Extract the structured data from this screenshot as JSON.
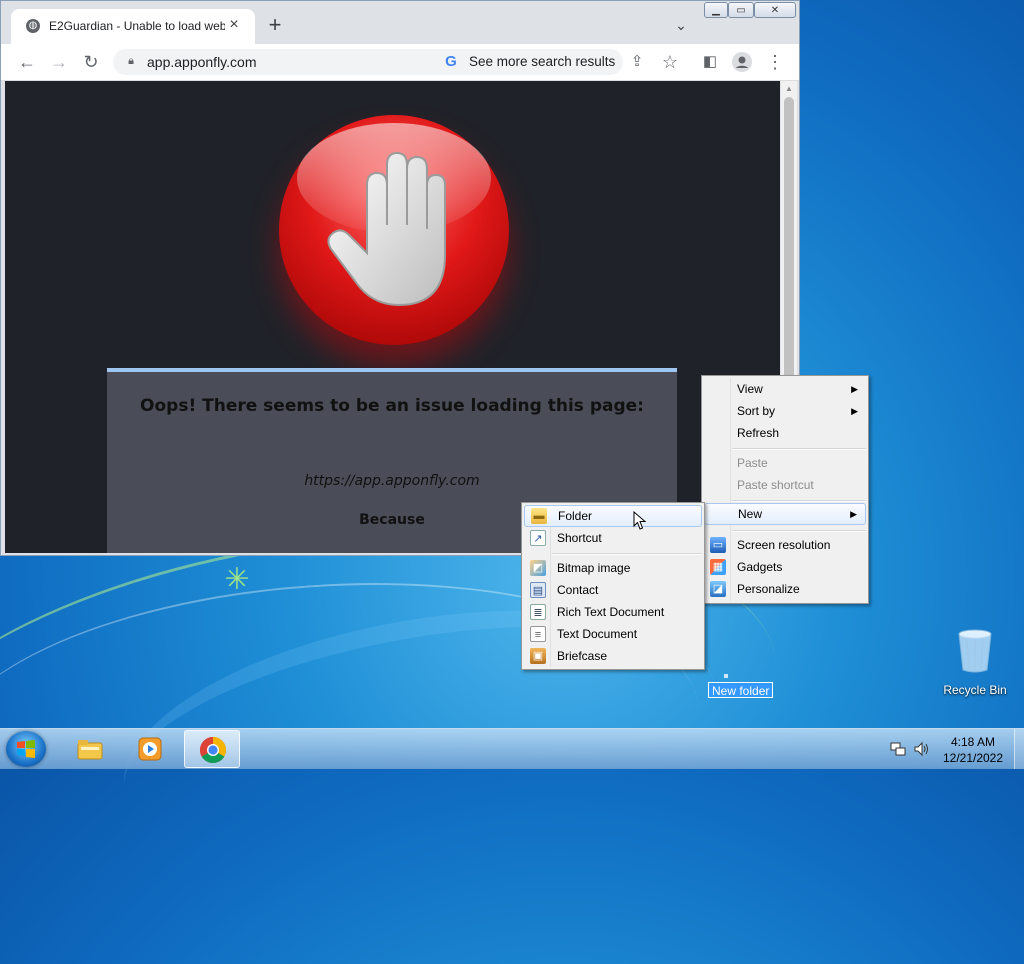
{
  "browser": {
    "tab_title": "E2Guardian - Unable to load web page",
    "url": "app.apponfly.com",
    "search_chip": "See more search results",
    "window_controls": {
      "minimize": "minimize-icon",
      "maximize": "maximize-icon",
      "close": "close-icon"
    }
  },
  "page": {
    "title": "Oops! There seems to be an issue loading this page:",
    "blocked_url": "https://app.apponfly.com",
    "because": "Because"
  },
  "context_menu": {
    "items": [
      {
        "label": "View",
        "submenu": true
      },
      {
        "label": "Sort by",
        "submenu": true
      },
      {
        "label": "Refresh"
      },
      {
        "label": "Paste",
        "disabled": true
      },
      {
        "label": "Paste shortcut",
        "disabled": true
      },
      {
        "label": "New",
        "submenu": true,
        "highlighted": true
      },
      {
        "label": "Screen resolution",
        "icon": "screen-resolution-icon"
      },
      {
        "label": "Gadgets",
        "icon": "gadgets-icon"
      },
      {
        "label": "Personalize",
        "icon": "personalize-icon"
      }
    ]
  },
  "new_submenu": {
    "items": [
      {
        "label": "Folder",
        "icon": "folder-icon",
        "highlighted": true
      },
      {
        "label": "Shortcut",
        "icon": "shortcut-icon"
      },
      {
        "label": "Bitmap image",
        "icon": "bitmap-icon"
      },
      {
        "label": "Contact",
        "icon": "contact-icon"
      },
      {
        "label": "Rich Text Document",
        "icon": "rich-text-icon"
      },
      {
        "label": "Text Document",
        "icon": "text-document-icon"
      },
      {
        "label": "Briefcase",
        "icon": "briefcase-icon"
      }
    ]
  },
  "desktop": {
    "new_folder_label": "New folder",
    "recycle_bin_label": "Recycle Bin"
  },
  "taskbar": {
    "time": "4:18 AM",
    "date": "12/21/2022"
  }
}
